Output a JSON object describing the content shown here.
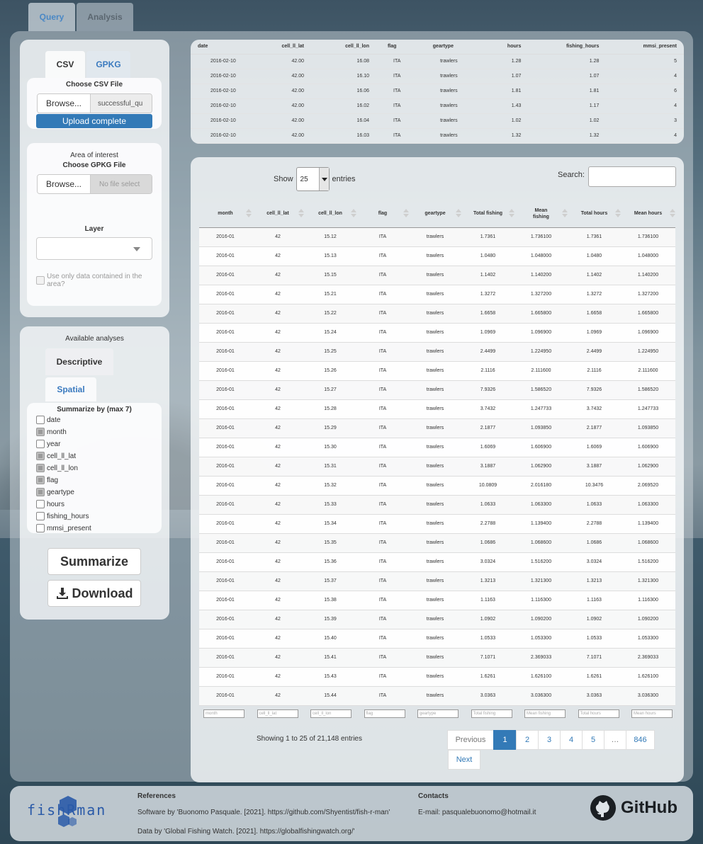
{
  "tabs": [
    "Query",
    "Analysis"
  ],
  "file_tabs": [
    "CSV",
    "GPKG"
  ],
  "csv": {
    "label": "Choose CSV File",
    "browse": "Browse...",
    "file_name": "successful_qu",
    "progress": "Upload complete"
  },
  "gpkg": {
    "area_label": "Area of interest",
    "label": "Choose GPKG File",
    "browse": "Browse...",
    "file_name": "No file select",
    "layer_label": "Layer",
    "use_area": "Use only data contained in the area?"
  },
  "analyses": {
    "title": "Available analyses",
    "tabs": [
      "Descriptive",
      "Spatial"
    ],
    "summarize_label": "Summarize by (max 7)",
    "fields": [
      {
        "label": "date",
        "checked": false
      },
      {
        "label": "month",
        "checked": true
      },
      {
        "label": "year",
        "checked": false
      },
      {
        "label": "cell_ll_lat",
        "checked": true
      },
      {
        "label": "cell_ll_lon",
        "checked": true
      },
      {
        "label": "flag",
        "checked": true
      },
      {
        "label": "geartype",
        "checked": true
      },
      {
        "label": "hours",
        "checked": false
      },
      {
        "label": "fishing_hours",
        "checked": false
      },
      {
        "label": "mmsi_present",
        "checked": false
      }
    ],
    "summarize_button": "Summarize",
    "download_button": "Download"
  },
  "preview": {
    "headers": [
      "date",
      "cell_ll_lat",
      "cell_ll_lon",
      "flag",
      "geartype",
      "hours",
      "fishing_hours",
      "mmsi_present"
    ],
    "rows": [
      [
        "2016-02-10",
        "42.00",
        "16.08",
        "ITA",
        "trawlers",
        "1.28",
        "1.28",
        "5"
      ],
      [
        "2016-02-10",
        "42.00",
        "16.10",
        "ITA",
        "trawlers",
        "1.07",
        "1.07",
        "4"
      ],
      [
        "2016-02-10",
        "42.00",
        "16.06",
        "ITA",
        "trawlers",
        "1.81",
        "1.81",
        "6"
      ],
      [
        "2016-02-10",
        "42.00",
        "16.02",
        "ITA",
        "trawlers",
        "1.43",
        "1.17",
        "4"
      ],
      [
        "2016-02-10",
        "42.00",
        "16.04",
        "ITA",
        "trawlers",
        "1.02",
        "1.02",
        "3"
      ],
      [
        "2016-02-10",
        "42.00",
        "16.03",
        "ITA",
        "trawlers",
        "1.32",
        "1.32",
        "4"
      ]
    ]
  },
  "results": {
    "show_label": "Show",
    "entries_value": "25",
    "entries_label": "entries",
    "search_label": "Search:",
    "headers": [
      "month",
      "cell_ll_lat",
      "cell_ll_lon",
      "flag",
      "geartype",
      "Total fishing",
      "Mean fishing",
      "Total hours",
      "Mean hours"
    ],
    "rows": [
      [
        "2016-01",
        "42",
        "15.12",
        "ITA",
        "trawlers",
        "1.7361",
        "1.736100",
        "1.7361",
        "1.736100"
      ],
      [
        "2016-01",
        "42",
        "15.13",
        "ITA",
        "trawlers",
        "1.0480",
        "1.048000",
        "1.0480",
        "1.048000"
      ],
      [
        "2016-01",
        "42",
        "15.15",
        "ITA",
        "trawlers",
        "1.1402",
        "1.140200",
        "1.1402",
        "1.140200"
      ],
      [
        "2016-01",
        "42",
        "15.21",
        "ITA",
        "trawlers",
        "1.3272",
        "1.327200",
        "1.3272",
        "1.327200"
      ],
      [
        "2016-01",
        "42",
        "15.22",
        "ITA",
        "trawlers",
        "1.6658",
        "1.665800",
        "1.6658",
        "1.665800"
      ],
      [
        "2016-01",
        "42",
        "15.24",
        "ITA",
        "trawlers",
        "1.0969",
        "1.096900",
        "1.0969",
        "1.096900"
      ],
      [
        "2016-01",
        "42",
        "15.25",
        "ITA",
        "trawlers",
        "2.4499",
        "1.224950",
        "2.4499",
        "1.224950"
      ],
      [
        "2016-01",
        "42",
        "15.26",
        "ITA",
        "trawlers",
        "2.1116",
        "2.111600",
        "2.1116",
        "2.111600"
      ],
      [
        "2016-01",
        "42",
        "15.27",
        "ITA",
        "trawlers",
        "7.9326",
        "1.586520",
        "7.9326",
        "1.586520"
      ],
      [
        "2016-01",
        "42",
        "15.28",
        "ITA",
        "trawlers",
        "3.7432",
        "1.247733",
        "3.7432",
        "1.247733"
      ],
      [
        "2016-01",
        "42",
        "15.29",
        "ITA",
        "trawlers",
        "2.1877",
        "1.093850",
        "2.1877",
        "1.093850"
      ],
      [
        "2016-01",
        "42",
        "15.30",
        "ITA",
        "trawlers",
        "1.6069",
        "1.606900",
        "1.6069",
        "1.606900"
      ],
      [
        "2016-01",
        "42",
        "15.31",
        "ITA",
        "trawlers",
        "3.1887",
        "1.062900",
        "3.1887",
        "1.062900"
      ],
      [
        "2016-01",
        "42",
        "15.32",
        "ITA",
        "trawlers",
        "10.0809",
        "2.016180",
        "10.3476",
        "2.069520"
      ],
      [
        "2016-01",
        "42",
        "15.33",
        "ITA",
        "trawlers",
        "1.0633",
        "1.063300",
        "1.0633",
        "1.063300"
      ],
      [
        "2016-01",
        "42",
        "15.34",
        "ITA",
        "trawlers",
        "2.2788",
        "1.139400",
        "2.2788",
        "1.139400"
      ],
      [
        "2016-01",
        "42",
        "15.35",
        "ITA",
        "trawlers",
        "1.0686",
        "1.068600",
        "1.0686",
        "1.068600"
      ],
      [
        "2016-01",
        "42",
        "15.36",
        "ITA",
        "trawlers",
        "3.0324",
        "1.516200",
        "3.0324",
        "1.516200"
      ],
      [
        "2016-01",
        "42",
        "15.37",
        "ITA",
        "trawlers",
        "1.3213",
        "1.321300",
        "1.3213",
        "1.321300"
      ],
      [
        "2016-01",
        "42",
        "15.38",
        "ITA",
        "trawlers",
        "1.1163",
        "1.116300",
        "1.1163",
        "1.116300"
      ],
      [
        "2016-01",
        "42",
        "15.39",
        "ITA",
        "trawlers",
        "1.0902",
        "1.090200",
        "1.0902",
        "1.090200"
      ],
      [
        "2016-01",
        "42",
        "15.40",
        "ITA",
        "trawlers",
        "1.0533",
        "1.053300",
        "1.0533",
        "1.053300"
      ],
      [
        "2016-01",
        "42",
        "15.41",
        "ITA",
        "trawlers",
        "7.1071",
        "2.369033",
        "7.1071",
        "2.369033"
      ],
      [
        "2016-01",
        "42",
        "15.43",
        "ITA",
        "trawlers",
        "1.6261",
        "1.626100",
        "1.6261",
        "1.626100"
      ],
      [
        "2016-01",
        "42",
        "15.44",
        "ITA",
        "trawlers",
        "3.0363",
        "3.036300",
        "3.0363",
        "3.036300"
      ]
    ],
    "filter_placeholders": [
      "month",
      "cell_ll_lat",
      "cell_ll_lon",
      "flag",
      "geartype",
      "Total fishing",
      "Mean fishing",
      "Total hours",
      "Mean hours"
    ],
    "info": "Showing 1 to 25 of 21,148 entries",
    "pagination": {
      "previous": "Previous",
      "pages": [
        "1",
        "2",
        "3",
        "4",
        "5",
        "…",
        "846"
      ],
      "next": "Next"
    }
  },
  "footer": {
    "logo": "fishRman",
    "references_title": "References",
    "software_ref": "Software by 'Buonomo Pasquale. [2021]. https://github.com/Shyentist/fish-r-man'",
    "data_ref": "Data by 'Global Fishing Watch. [2021]. https://globalfishingwatch.org/'",
    "contacts_title": "Contacts",
    "email": "E-mail: pasqualebuonomo@hotmail.it",
    "github": "GitHub"
  },
  "colors": {
    "accent": "#337ab7",
    "tab_active": "#4a88c5",
    "logo": "#2a5aa8"
  }
}
